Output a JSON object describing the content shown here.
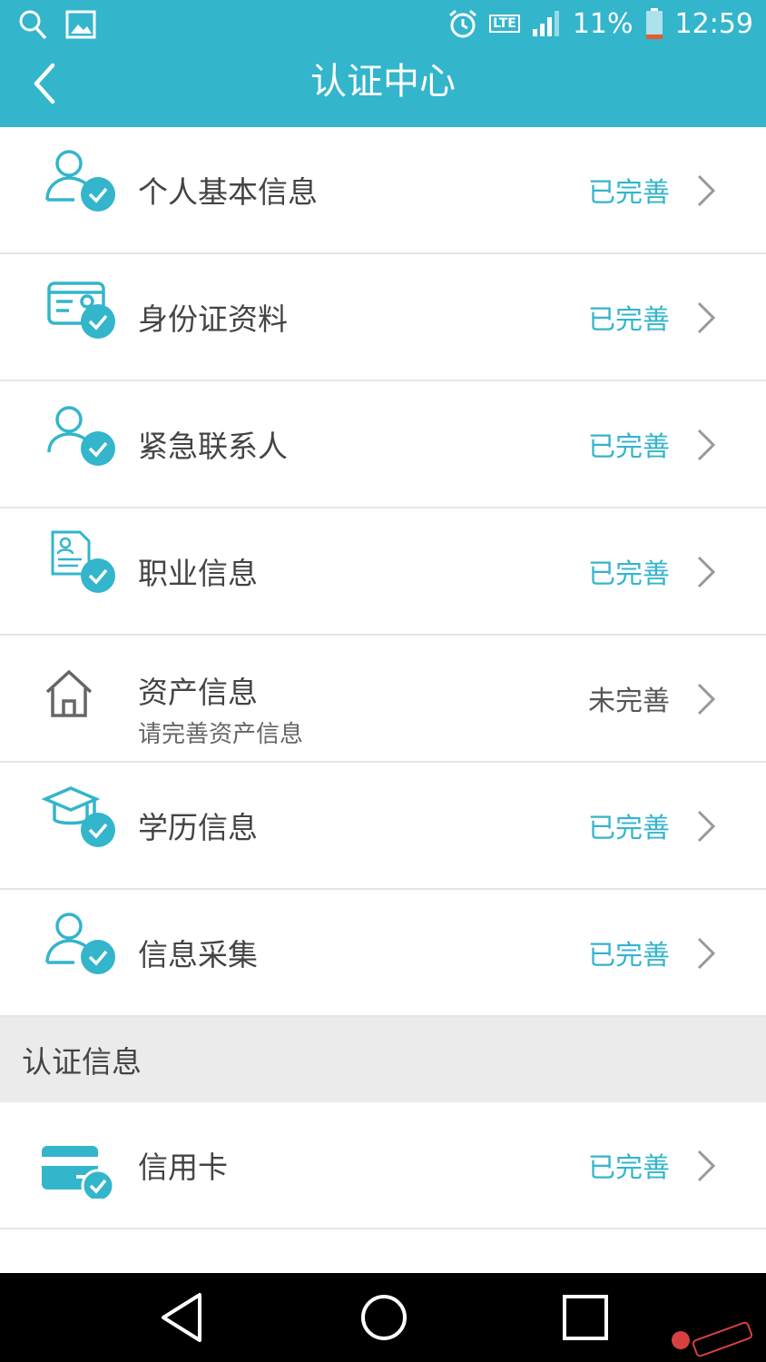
{
  "status_bar": {
    "network": "LTE",
    "battery": "11%",
    "time": "12:59"
  },
  "header": {
    "title": "认证中心"
  },
  "items": [
    {
      "label": "个人基本信息",
      "status": "已完善",
      "icon": "person-check-icon"
    },
    {
      "label": "身份证资料",
      "status": "已完善",
      "icon": "id-card-check-icon"
    },
    {
      "label": "紧急联系人",
      "status": "已完善",
      "icon": "contact-check-icon"
    },
    {
      "label": "职业信息",
      "status": "已完善",
      "icon": "document-check-icon"
    },
    {
      "label": "资产信息",
      "sublabel": "请完善资产信息",
      "status": "未完善",
      "icon": "house-icon"
    },
    {
      "label": "学历信息",
      "status": "已完善",
      "icon": "graduation-cap-check-icon"
    },
    {
      "label": "信息采集",
      "status": "已完善",
      "icon": "person-check-icon"
    }
  ],
  "section": {
    "title": "认证信息"
  },
  "auth_items": [
    {
      "label": "信用卡",
      "status": "已完善",
      "icon": "credit-card-check-icon"
    }
  ],
  "colors": {
    "accent": "#33b5cc",
    "pending": "#555555"
  }
}
